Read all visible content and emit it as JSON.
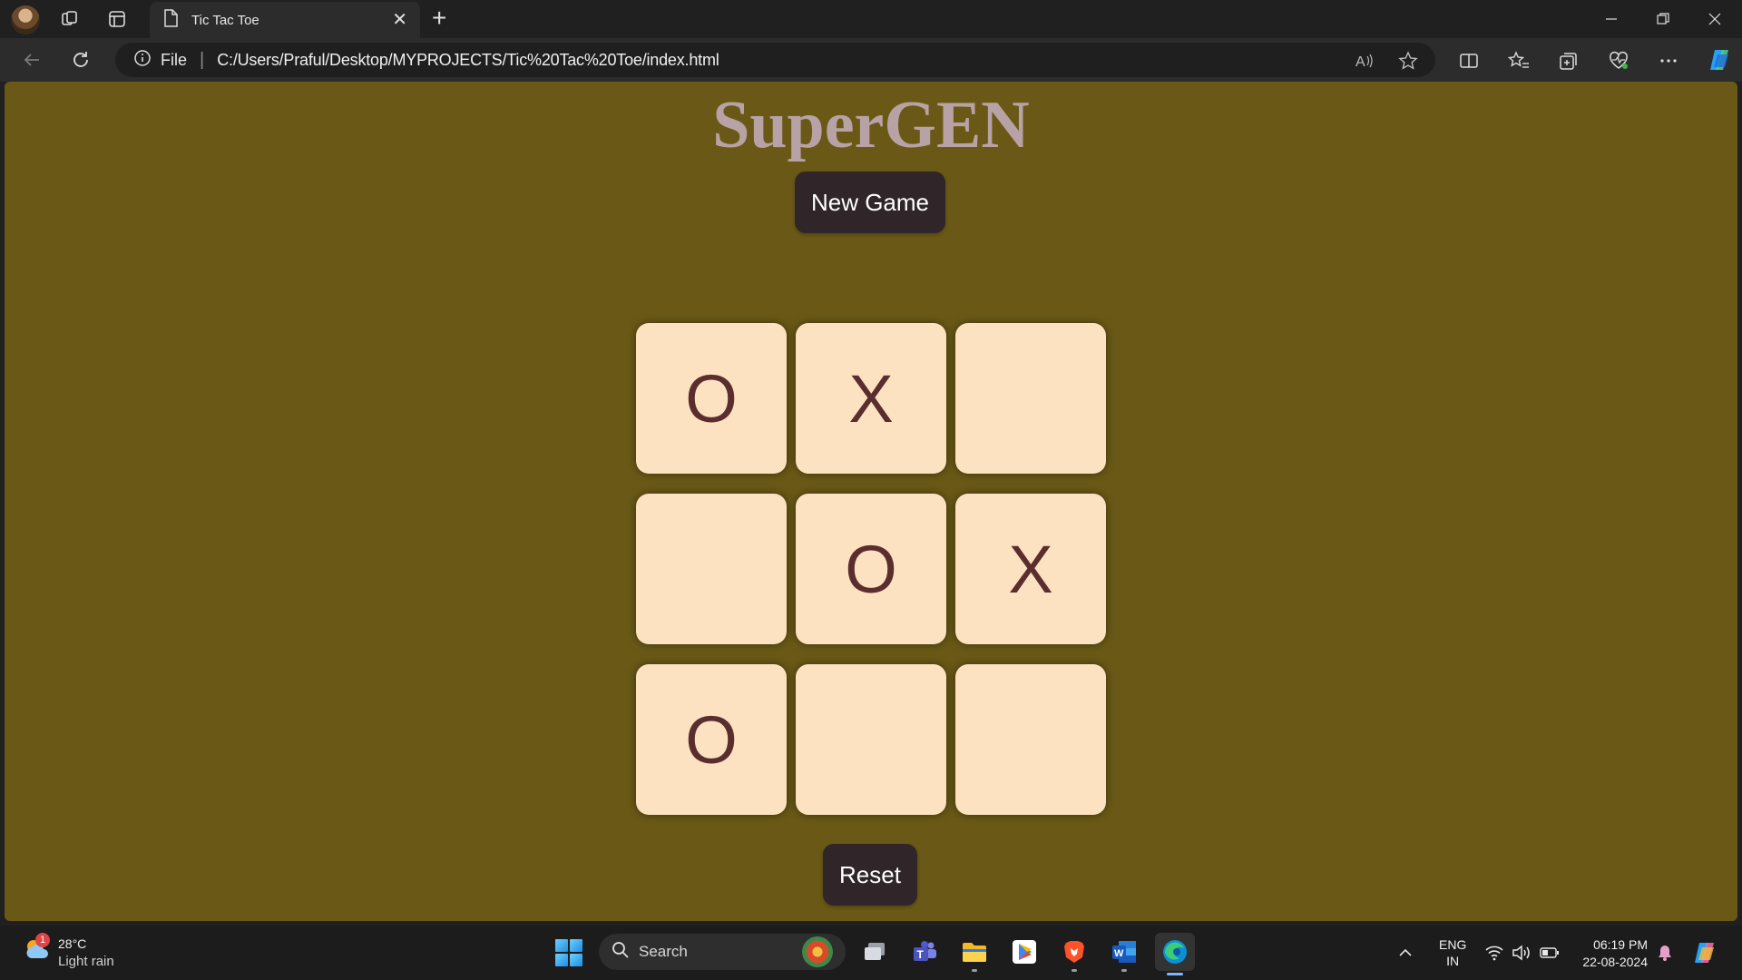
{
  "browser": {
    "tab_title": "Tic Tac Toe",
    "address_prefix": "File",
    "url": "C:/Users/Praful/Desktop/MYPROJECTS/Tic%20Tac%20Toe/index.html"
  },
  "page": {
    "title": "SuperGEN",
    "new_game_label": "New Game",
    "reset_label": "Reset",
    "board": [
      [
        "O",
        "X",
        ""
      ],
      [
        "",
        "O",
        "X"
      ],
      [
        "O",
        "",
        ""
      ]
    ],
    "colors": {
      "background": "#6a5916",
      "title": "#b8a2a5",
      "button": "#302528",
      "cell": "#fde2c2",
      "mark": "#5a2e2e"
    }
  },
  "taskbar": {
    "weather_temp": "28°C",
    "weather_condition": "Light rain",
    "weather_badge": "1",
    "search_label": "Search",
    "language_line1": "ENG",
    "language_line2": "IN",
    "time": "06:19 PM",
    "date": "22-08-2024",
    "apps": [
      "task-view",
      "teams",
      "file-explorer",
      "play-store",
      "brave",
      "word",
      "edge"
    ]
  }
}
